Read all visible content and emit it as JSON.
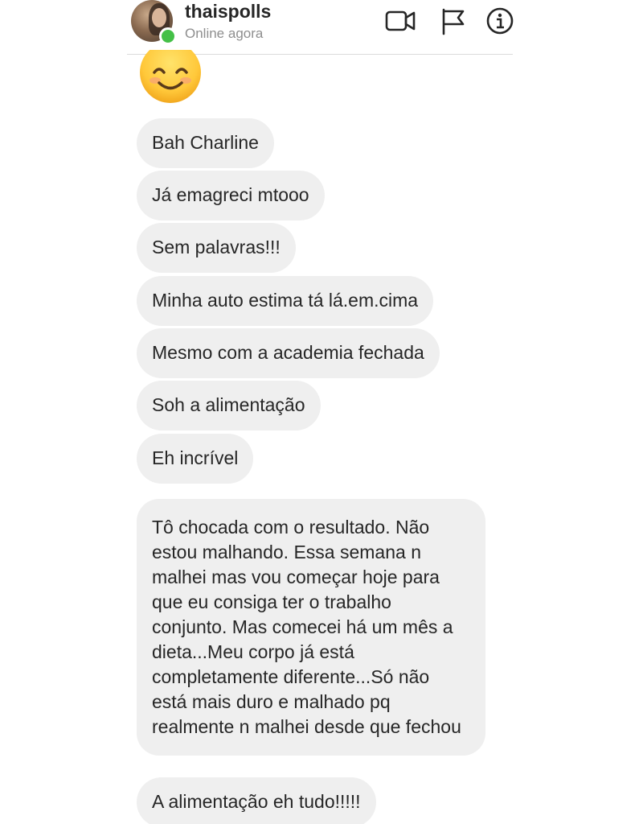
{
  "header": {
    "username": "thaispolls",
    "status": "Online agora",
    "icons": [
      "video-camera-icon",
      "flag-icon",
      "info-icon"
    ],
    "online_color": "#44c047"
  },
  "messages": [
    {
      "type": "emoji",
      "content": "smiling-face-emoji"
    },
    {
      "type": "text",
      "text": "Bah Charline"
    },
    {
      "type": "text",
      "text": "Já emagreci mtooo"
    },
    {
      "type": "text",
      "text": "Sem palavras!!!"
    },
    {
      "type": "text",
      "text": "Minha auto estima tá lá.em.cima"
    },
    {
      "type": "text",
      "text": "Mesmo com a academia fechada"
    },
    {
      "type": "text",
      "text": "Soh a alimentação"
    },
    {
      "type": "text",
      "text": "Eh incrível"
    },
    {
      "type": "text",
      "text": "Tô chocada com o resultado. Não estou malhando. Essa semana n malhei mas vou começar hoje para que eu consiga ter o trabalho conjunto. Mas comecei há um mês a dieta...Meu corpo já está completamente diferente...Só não está mais duro e malhado pq realmente n malhei desde que fechou"
    },
    {
      "type": "text",
      "text": "A alimentação eh tudo!!!!!"
    }
  ],
  "colors": {
    "bubble_bg": "#efefef",
    "text": "#262626",
    "secondary_text": "#8e8e8e"
  }
}
